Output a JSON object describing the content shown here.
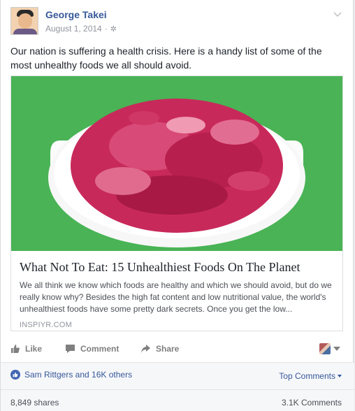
{
  "post": {
    "author": "George Takei",
    "date": "August 1, 2014",
    "date_separator": "·",
    "privacy_icon": "gear-icon",
    "menu_icon": "chevron-down-icon",
    "status_text": "Our nation is suffering a health crisis. Here is a handy list of some of the most unhealthy foods we all should avoid."
  },
  "link_preview": {
    "image": "bowl-of-pink-food-image",
    "title": "What Not To Eat: 15 Unhealthiest Foods On The Planet",
    "description": "We all think we know which foods are healthy and which we should avoid, but do we really know why? Besides the high fat content and low nutritional value, the world's unhealthiest foods have some pretty dark secrets. Once you get the low...",
    "domain": "INSPIYR.COM"
  },
  "actions": {
    "like_label": "Like",
    "comment_label": "Comment",
    "share_label": "Share"
  },
  "engagement": {
    "likes_text": "Sam Rittgers and 16K others",
    "top_comments_label": "Top Comments",
    "shares_text": "8,849 shares",
    "comments_text": "3.1K Comments"
  },
  "colors": {
    "link_blue": "#365899",
    "action_gray": "#7f7f7f",
    "like_badge": "#4267b2",
    "image_background": "#49b355",
    "bowl_food": "#c8295b"
  }
}
